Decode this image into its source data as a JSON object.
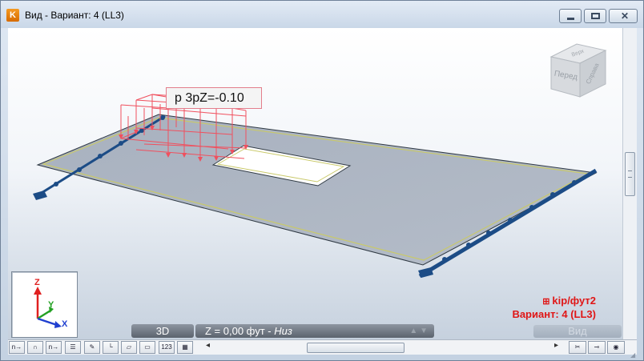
{
  "window": {
    "title": "Вид - Вариант: 4 (LL3)",
    "app_icon_letter": "K"
  },
  "viewport": {
    "tooltip": "p 3pZ=-0.10",
    "navcube": {
      "front_label": "Перед",
      "right_label": "Справа",
      "top_label": "Верх"
    },
    "axis_labels": {
      "x": "X",
      "y": "Y",
      "z": "Z"
    },
    "legend": {
      "unit": "kip/фут2",
      "case": "Вариант: 4 (LL3)"
    },
    "status": {
      "mode": "3D",
      "plane_prefix": "Z = 0,00 фут - ",
      "plane_name": "Низ",
      "view": "Вид"
    }
  },
  "toolbar": {
    "buttons": [
      {
        "name": "nodes-button",
        "label": "n→"
      },
      {
        "name": "supports-button",
        "label": "∩"
      },
      {
        "name": "members-button",
        "label": "n→"
      },
      {
        "name": "loads-button",
        "label": "☰"
      },
      {
        "name": "sections-button",
        "label": "✎"
      },
      {
        "name": "axes-button",
        "label": "└"
      },
      {
        "name": "plates-button",
        "label": "▱"
      },
      {
        "name": "panels-button",
        "label": "▭"
      },
      {
        "name": "numbering-button",
        "label": "123"
      },
      {
        "name": "grid-button",
        "label": "▦"
      }
    ]
  },
  "colors": {
    "slab": "#a9b2c1",
    "slab_edge": "#c9c96a",
    "support": "#1c4c86",
    "load": "#f0505e",
    "legend": "#e01616"
  }
}
